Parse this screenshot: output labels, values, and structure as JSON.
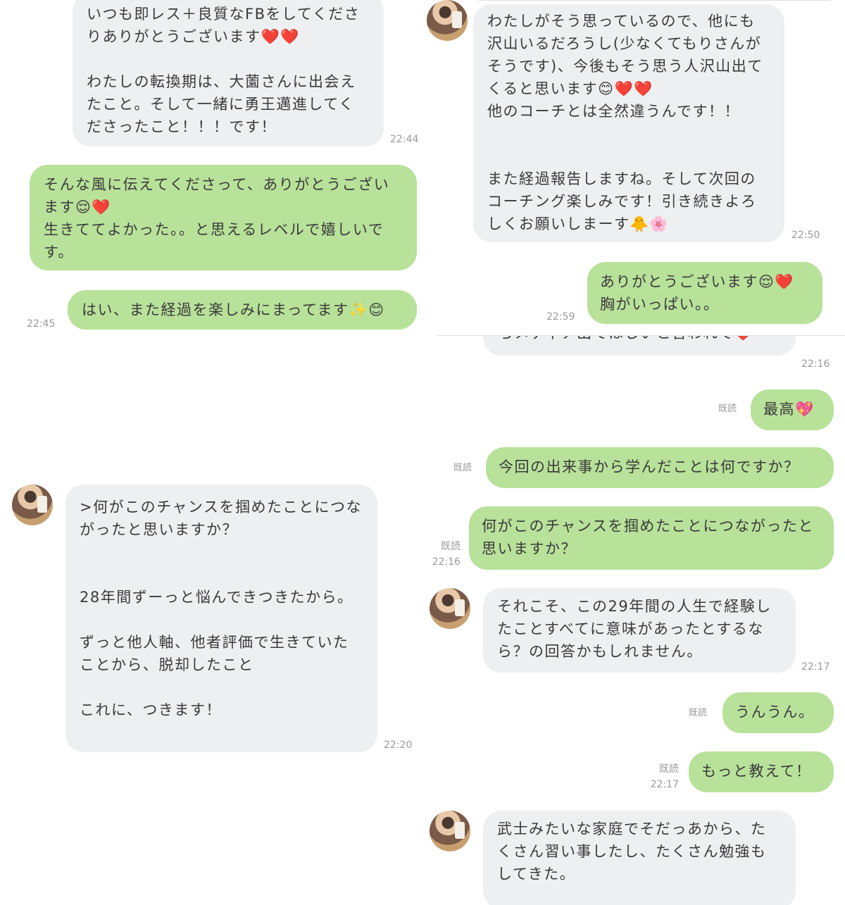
{
  "panel_top_left": {
    "messages": [
      {
        "text": "いつも即レス＋良質なFBをしてくださりありがとうございます❤️❤️\n\nわたしの転換期は、大薗さんに出会えたこと。そして一緒に勇王邁進してくださったこと！！！です！",
        "time": "22:44"
      },
      {
        "text": "そんな風に伝えてくださって、ありがとうございます😌❤️\n生きててよかった。。と思えるレベルで嬉しいです。"
      },
      {
        "text": "はい、また経過を楽しみにまってます✨😊",
        "time": "22:45"
      }
    ]
  },
  "panel_top_right": {
    "messages": [
      {
        "text": "わたしがそう思っているので、他にも沢山いるだろうし(少なくてもりさんがそうです)、今後もそう思う人沢山出てくると思います😊❤️❤️\n他のコーチとは全然違うんです！！\n\n\nまた経過報告しますね。そして次回のコーチング楽しみです！引き続きよろしくお願いしまーす🐥🌸",
        "time": "22:50"
      },
      {
        "text": "ありがとうございます😌❤️\n胸がいっぱい。。",
        "time": "22:59"
      }
    ]
  },
  "panel_bottom_left": {
    "messages": [
      {
        "text": ">何がこのチャンスを掴めたことにつながったと思いますか？\n\n\n28年間ずーっと悩んできつきたから。\n\nずっと他人軸、他者評価で生きていたことから、脱却したこと\n\nこれに、つきます！",
        "time": "22:20"
      }
    ]
  },
  "panel_bottom_right": {
    "messages": [
      {
        "text": "らメディア出てほしいと言われて❤️",
        "time": "22:16"
      },
      {
        "text": "最高💖",
        "read": "既読"
      },
      {
        "text": "今回の出来事から学んだことは何ですか？",
        "read": "既読"
      },
      {
        "text": "何がこのチャンスを掴めたことにつながったと思いますか？",
        "read": "既読",
        "time": "22:16"
      },
      {
        "text": "それこそ、この29年間の人生で経験したことすべてに意味があったとするなら？の回答かもしれません。",
        "time": "22:17"
      },
      {
        "text": "うんうん。",
        "read": "既読"
      },
      {
        "text": "もっと教えて！",
        "read": "既読",
        "time": "22:17"
      },
      {
        "text": "武士みたいな家庭でそだっあから、たくさん習い事したし、たくさん勉強もしてきた。"
      }
    ]
  }
}
